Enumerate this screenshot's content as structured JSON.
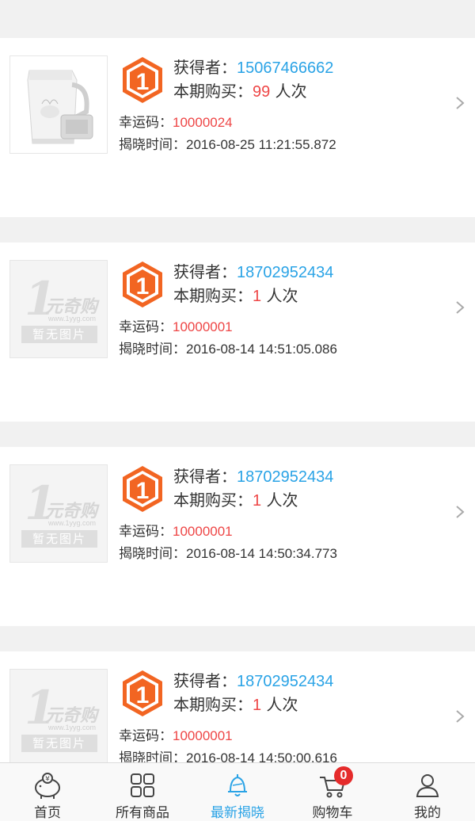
{
  "feed": {
    "items": [
      {
        "winner_label": "获得者：",
        "winner": "15067466662",
        "buy_label": "本期购买：",
        "buy_count": "99",
        "buy_unit": " 人次",
        "code_label": "幸运码：",
        "code": "10000024",
        "time_label": "揭晓时间：",
        "time": "2016-08-25 11:21:55.872",
        "image": "soymilk-maker"
      },
      {
        "winner_label": "获得者：",
        "winner": "18702952434",
        "buy_label": "本期购买：",
        "buy_count": "1",
        "buy_unit": " 人次",
        "code_label": "幸运码：",
        "code": "10000001",
        "time_label": "揭晓时间：",
        "time": "2016-08-14 14:51:05.086",
        "image": "placeholder"
      },
      {
        "winner_label": "获得者：",
        "winner": "18702952434",
        "buy_label": "本期购买：",
        "buy_count": "1",
        "buy_unit": " 人次",
        "code_label": "幸运码：",
        "code": "10000001",
        "time_label": "揭晓时间：",
        "time": "2016-08-14 14:50:34.773",
        "image": "placeholder"
      },
      {
        "winner_label": "获得者：",
        "winner": "18702952434",
        "buy_label": "本期购买：",
        "buy_count": "1",
        "buy_unit": " 人次",
        "code_label": "幸运码：",
        "code": "10000001",
        "time_label": "揭晓时间：",
        "time": "2016-08-14 14:50:00.616",
        "image": "placeholder"
      }
    ],
    "badge_digit": "1",
    "placeholder": {
      "brand": "元奇购",
      "url": "www.1yyg.com",
      "banner": "暂无图片"
    }
  },
  "tabbar": {
    "tabs": [
      {
        "label": "首页",
        "icon": "piggy-bank-icon"
      },
      {
        "label": "所有商品",
        "icon": "grid-icon"
      },
      {
        "label": "最新揭晓",
        "icon": "bell-icon",
        "active": true
      },
      {
        "label": "购物车",
        "icon": "cart-icon",
        "badge": "0"
      },
      {
        "label": "我的",
        "icon": "user-icon"
      }
    ]
  },
  "colors": {
    "accent": "#2aa3e6",
    "red": "#ee4646",
    "badge_orange": "#f26522"
  }
}
